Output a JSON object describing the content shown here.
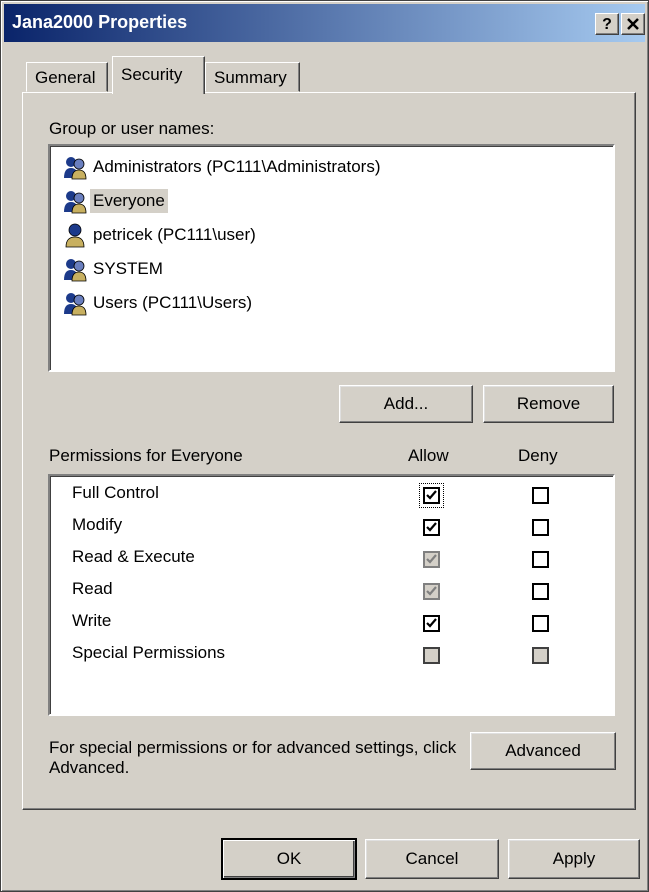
{
  "window": {
    "title": "Jana2000 Properties",
    "help_label": "?",
    "close_label": "X"
  },
  "tabs": [
    {
      "label": "General"
    },
    {
      "label": "Security"
    },
    {
      "label": "Summary"
    }
  ],
  "users_section": {
    "label": "Group or user names:",
    "items": [
      {
        "label": "Administrators (PC111\\Administrators)",
        "icon": "group-icon"
      },
      {
        "label": "Everyone",
        "icon": "group-icon"
      },
      {
        "label": "petricek (PC111\\user)",
        "icon": "user-icon"
      },
      {
        "label": "SYSTEM",
        "icon": "group-icon"
      },
      {
        "label": "Users (PC111\\Users)",
        "icon": "group-icon"
      }
    ],
    "selected": "Everyone",
    "add_label": "Add...",
    "remove_label": "Remove"
  },
  "permissions": {
    "title": "Permissions for Everyone",
    "allow_header": "Allow",
    "deny_header": "Deny",
    "rows": [
      {
        "name": "Full Control",
        "allow": "checked",
        "deny": "unchecked"
      },
      {
        "name": "Modify",
        "allow": "checked",
        "deny": "unchecked"
      },
      {
        "name": "Read & Execute",
        "allow": "checked-disabled",
        "deny": "unchecked"
      },
      {
        "name": "Read",
        "allow": "checked-disabled",
        "deny": "unchecked"
      },
      {
        "name": "Write",
        "allow": "checked",
        "deny": "unchecked"
      },
      {
        "name": "Special Permissions",
        "allow": "disabled",
        "deny": "disabled"
      }
    ]
  },
  "advanced": {
    "note": "For special permissions or for advanced settings, click Advanced.",
    "button_label": "Advanced"
  },
  "footer": {
    "ok_label": "OK",
    "cancel_label": "Cancel",
    "apply_label": "Apply"
  },
  "colors": {
    "face": "#d4d0c8",
    "title_start": "#0a246a",
    "title_end": "#a6caf0"
  }
}
